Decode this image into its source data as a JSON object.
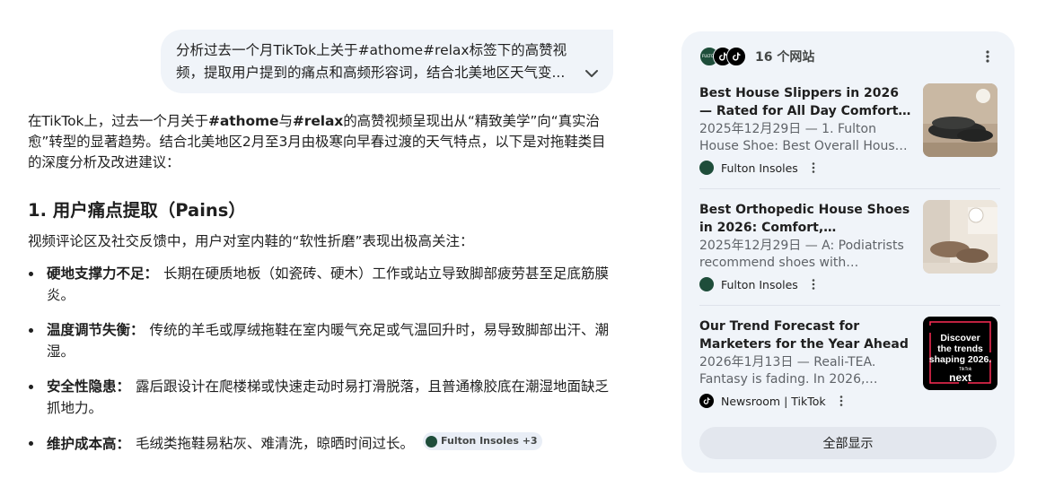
{
  "user_message": {
    "text": "分析过去一个月TikTok上关于#athome#relax标签下的高赞视频，提取用户提到的痛点和高频形容词，结合北美地区天气变..."
  },
  "answer": {
    "intro_parts": [
      "在TikTok上，过去一个月关于",
      "#athome",
      "与",
      "#relax",
      "的高赞视频呈现出从“精致美学”向“真实治愈”转型的显著趋势。结合北美地区2月至3月由极寒向早春过渡的天气特点，以下是对拖鞋类目的深度分析及改进建议："
    ],
    "section_title": "1. 用户痛点提取（Pains）",
    "lead": "视频评论区及社交反馈中，用户对室内鞋的“软性折磨”表现出极高关注：",
    "pains": [
      {
        "label": "硬地支撑力不足：",
        "text": "长期在硬质地板（如瓷砖、硬木）工作或站立导致脚部疲劳甚至足底筋膜炎。"
      },
      {
        "label": "温度调节失衡：",
        "text": "传统的羊毛或厚绒拖鞋在室内暖气充足或气温回升时，易导致脚部出汗、潮湿。"
      },
      {
        "label": "安全性隐患：",
        "text": "露后跟设计在爬楼梯或快速走动时易打滑脱落，且普通橡胶底在潮湿地面缺乏抓地力。"
      },
      {
        "label": "维护成本高：",
        "text": "毛绒类拖鞋易粘灰、难清洗，晾晒时间过长。"
      }
    ],
    "source_chip": "Fulton Insoles +3"
  },
  "sources": {
    "count_label": "16 个网站",
    "header_logo_text": "FULTON",
    "items": [
      {
        "title": "Best House Slippers in 2026 — Rated for All Day Comfort and ...",
        "snippet": "2025年12月29日 — 1. Fulton House Shoe: Best Overall House Shoe for...",
        "site": "Fulton Insoles",
        "logo": "fulton"
      },
      {
        "title": "Best Orthopedic House Shoes in 2026: Comfort, Breathability, and...",
        "snippet": "2025年12月29日 — A: Podiatrists recommend shoes with supportive...",
        "site": "Fulton Insoles",
        "logo": "fulton"
      },
      {
        "title": "Our Trend Forecast for Marketers for the Year Ahead",
        "snippet": "2026年1月13日 — Reali-TEA. Fantasy is fading. In 2026, audiences will...",
        "site": "Newsroom | TikTok",
        "logo": "tiktok",
        "thumb_lines": [
          "Discover",
          "the trends",
          "shaping 2026."
        ],
        "thumb_brand_small": "TikTok",
        "thumb_brand_big": "next"
      }
    ],
    "show_all_label": "全部显示"
  },
  "colors": {
    "panel_bg": "#f0f4f9",
    "bubble_bg": "#f0f4f9",
    "fulton_green": "#1e4d3a",
    "tiktok_accent": "#fe2c55"
  }
}
